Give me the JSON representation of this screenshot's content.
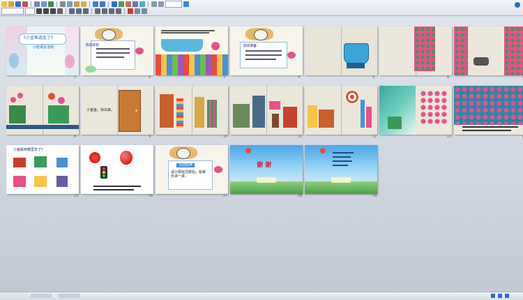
{
  "slides": [
    {
      "num": "1",
      "title": "《小金鱼逃走了》",
      "subtitle": "小班语言活动"
    },
    {
      "num": "2",
      "title": "活动目标"
    },
    {
      "num": "3"
    },
    {
      "num": "4",
      "title": "活动准备："
    },
    {
      "num": "5"
    },
    {
      "num": "6"
    },
    {
      "num": "7"
    },
    {
      "num": "8"
    },
    {
      "num": "9",
      "text": "小金鱼，快出来。"
    },
    {
      "num": "10"
    },
    {
      "num": "11"
    },
    {
      "num": "12"
    },
    {
      "num": "13"
    },
    {
      "num": "14"
    },
    {
      "num": "15",
      "title": "小鱼躲到哪里去了？"
    },
    {
      "num": "16"
    },
    {
      "num": "17",
      "title": "活动延伸",
      "text": "请小朋友回家后，给家长讲一讲。"
    },
    {
      "num": "18",
      "title": "谢  谢"
    },
    {
      "num": "19"
    }
  ],
  "colors": {
    "sorter_bg": "#dfe4ec",
    "accent": "#2f6bd8"
  }
}
